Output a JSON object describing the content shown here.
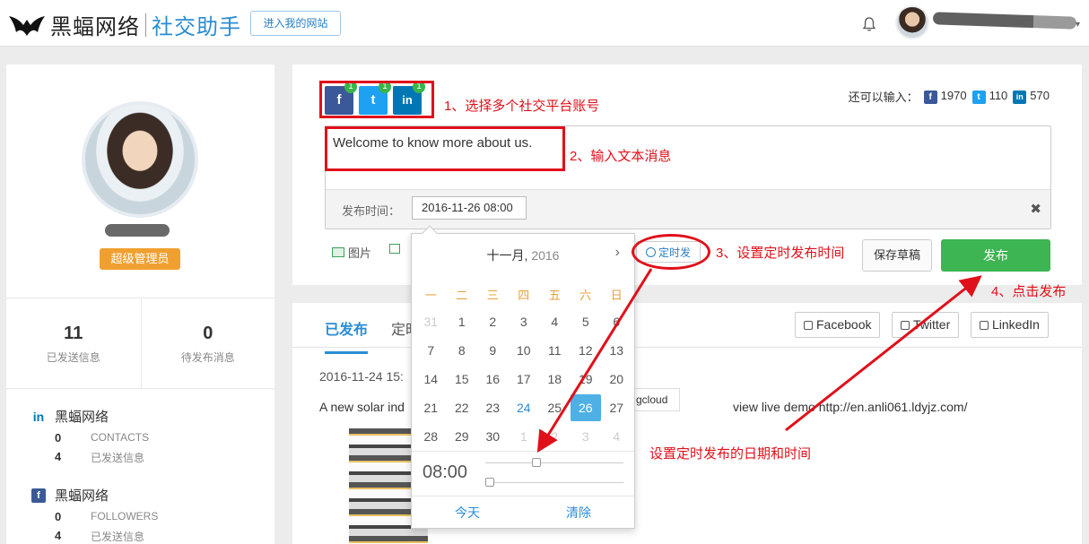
{
  "header": {
    "brand_name": "黑蝠网络",
    "brand_sub": "社交助手",
    "enter_site": "进入我的网站"
  },
  "profile": {
    "role": "超级管理员",
    "stats": [
      {
        "value": "11",
        "label": "已发送信息"
      },
      {
        "value": "0",
        "label": "待发布消息"
      }
    ],
    "accounts": [
      {
        "name": "黑蝠网络",
        "network": "linkedin",
        "rows": [
          {
            "n": "0",
            "l": "CONTACTS"
          },
          {
            "n": "4",
            "l": "已发送信息"
          }
        ]
      },
      {
        "name": "黑蝠网络",
        "network": "facebook",
        "rows": [
          {
            "n": "0",
            "l": "FOLLOWERS"
          },
          {
            "n": "4",
            "l": "已发送信息"
          }
        ]
      }
    ]
  },
  "compose": {
    "networks": [
      {
        "icon": "f",
        "count": "1",
        "color": "#3b5998"
      },
      {
        "icon": "t",
        "count": "1",
        "color": "#1da1f2"
      },
      {
        "icon": "in",
        "count": "1",
        "color": "#0077b5"
      }
    ],
    "remain_label": "还可以输入：",
    "remain": [
      {
        "icon": "f",
        "value": "1970",
        "color": "#3b5998"
      },
      {
        "icon": "t",
        "value": "110",
        "color": "#1da1f2"
      },
      {
        "icon": "in",
        "value": "570",
        "color": "#0077b5"
      }
    ],
    "message": "Welcome to know more about us.",
    "time_label": "发布时间：",
    "time_value": "2016-11-26 08:00",
    "clear": "✖",
    "tool_image": "图片",
    "schedule_btn": "定时发",
    "draft_btn": "保存草稿",
    "publish_btn": "发布"
  },
  "feed": {
    "tab_published": "已发布",
    "tab_scheduled": "定时",
    "filters": [
      "Facebook",
      "Twitter",
      "LinkedIn"
    ],
    "post_date": "2016-11-24 15:",
    "post_text": "A new solar ind",
    "post_text_tail": "view live demo http://en.anli061.ldyjz.com/",
    "tag_pill": "gcloud"
  },
  "calendar": {
    "month": "十一月,",
    "year": "2016",
    "weekdays": [
      "一",
      "二",
      "三",
      "四",
      "五",
      "六",
      "日"
    ],
    "weeks": [
      [
        "31",
        "1",
        "2",
        "3",
        "4",
        "5",
        "6"
      ],
      [
        "7",
        "8",
        "9",
        "10",
        "11",
        "12",
        "13"
      ],
      [
        "14",
        "15",
        "16",
        "17",
        "18",
        "19",
        "20"
      ],
      [
        "21",
        "22",
        "23",
        "24",
        "25",
        "26",
        "27"
      ],
      [
        "28",
        "29",
        "30",
        "1",
        "2",
        "3",
        "4"
      ]
    ],
    "today": "24",
    "selected": "26",
    "time": "08:00",
    "hour_fraction": 0.36,
    "minute_fraction": 0.0,
    "btn_today": "今天",
    "btn_clear": "清除"
  },
  "annotations": {
    "step1": "1、选择多个社交平台账号",
    "step2": "2、输入文本消息",
    "step3": "3、设置定时发布时间",
    "step4": "4、点击发布",
    "date_note": "设置定时发布的日期和时间"
  }
}
